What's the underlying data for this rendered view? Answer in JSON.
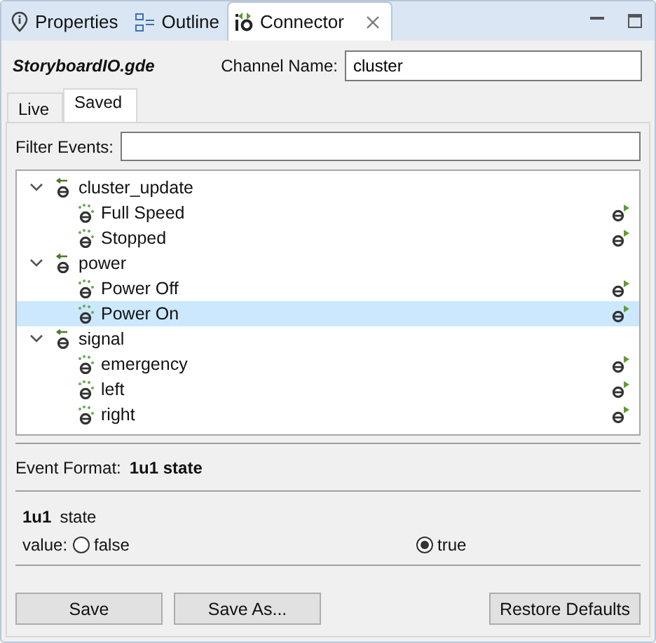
{
  "view_tabs": [
    {
      "label": "Properties",
      "kind": "properties",
      "selected": false
    },
    {
      "label": "Outline",
      "kind": "outline",
      "selected": false
    },
    {
      "label": "Connector",
      "kind": "connector",
      "selected": true
    }
  ],
  "file_name": "StoryboardIO.gde",
  "channel": {
    "label": "Channel Name:",
    "value": "cluster"
  },
  "sub_tabs": [
    {
      "label": "Live",
      "selected": false
    },
    {
      "label": "Saved",
      "selected": true
    }
  ],
  "filter": {
    "label": "Filter Events:"
  },
  "tree": [
    {
      "label": "cluster_update",
      "expanded": true,
      "children": [
        {
          "label": "Full Speed",
          "selected": false
        },
        {
          "label": "Stopped",
          "selected": false
        }
      ]
    },
    {
      "label": "power",
      "expanded": true,
      "children": [
        {
          "label": "Power Off",
          "selected": false
        },
        {
          "label": "Power On",
          "selected": true
        }
      ]
    },
    {
      "label": "signal",
      "expanded": true,
      "children": [
        {
          "label": "emergency",
          "selected": false
        },
        {
          "label": "left",
          "selected": false
        },
        {
          "label": "right",
          "selected": false
        }
      ]
    }
  ],
  "event_format": {
    "label": "Event Format:",
    "value": "1u1 state"
  },
  "field": {
    "type": "1u1",
    "name": "state",
    "value_label": "value:",
    "options": [
      {
        "label": "false",
        "selected": false
      },
      {
        "label": "true",
        "selected": true
      }
    ]
  },
  "buttons": [
    {
      "label": "Save",
      "kind": "left"
    },
    {
      "label": "Save As...",
      "kind": "left"
    },
    {
      "label": "Restore Defaults",
      "kind": "right"
    }
  ]
}
